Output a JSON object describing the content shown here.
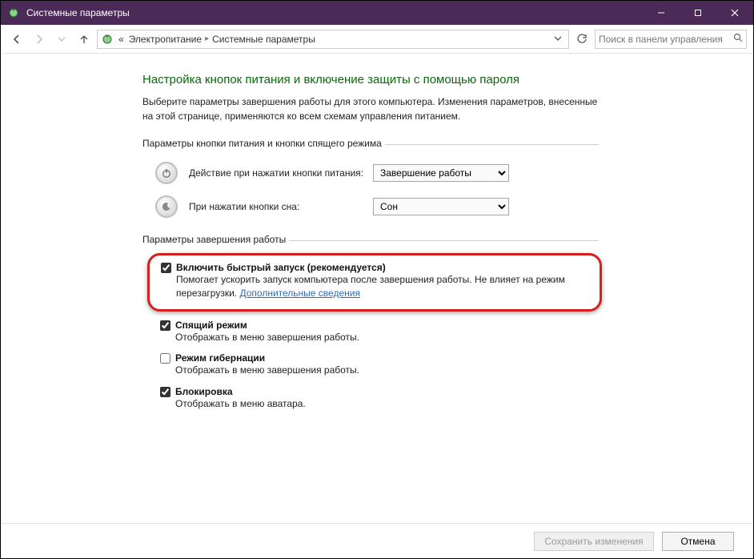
{
  "window": {
    "title": "Системные параметры"
  },
  "breadcrumb": {
    "prefix": "«",
    "items": [
      "Электропитание",
      "Системные параметры"
    ]
  },
  "search": {
    "placeholder": "Поиск в панели управления"
  },
  "page": {
    "title": "Настройка кнопок питания и включение защиты с помощью пароля",
    "desc": "Выберите параметры завершения работы для этого компьютера. Изменения параметров, внесенные на этой странице, применяются ко всем схемам управления питанием."
  },
  "section_buttons": {
    "legend": "Параметры кнопки питания и кнопки спящего режима",
    "rows": [
      {
        "label": "Действие при нажатии кнопки питания:",
        "value": "Завершение работы"
      },
      {
        "label": "При нажатии кнопки сна:",
        "value": "Сон"
      }
    ]
  },
  "section_shutdown": {
    "legend": "Параметры завершения работы",
    "options": [
      {
        "checked": true,
        "title": "Включить быстрый запуск (рекомендуется)",
        "desc": "Помогает ускорить запуск компьютера после завершения работы. Не влияет на режим перезагрузки. ",
        "link": "Дополнительные сведения",
        "highlight": true
      },
      {
        "checked": true,
        "title": "Спящий режим",
        "desc": "Отображать в меню завершения работы."
      },
      {
        "checked": false,
        "title": "Режим гибернации",
        "desc": "Отображать в меню завершения работы."
      },
      {
        "checked": true,
        "title": "Блокировка",
        "desc": "Отображать в меню аватара."
      }
    ]
  },
  "footer": {
    "save": "Сохранить изменения",
    "cancel": "Отмена"
  }
}
